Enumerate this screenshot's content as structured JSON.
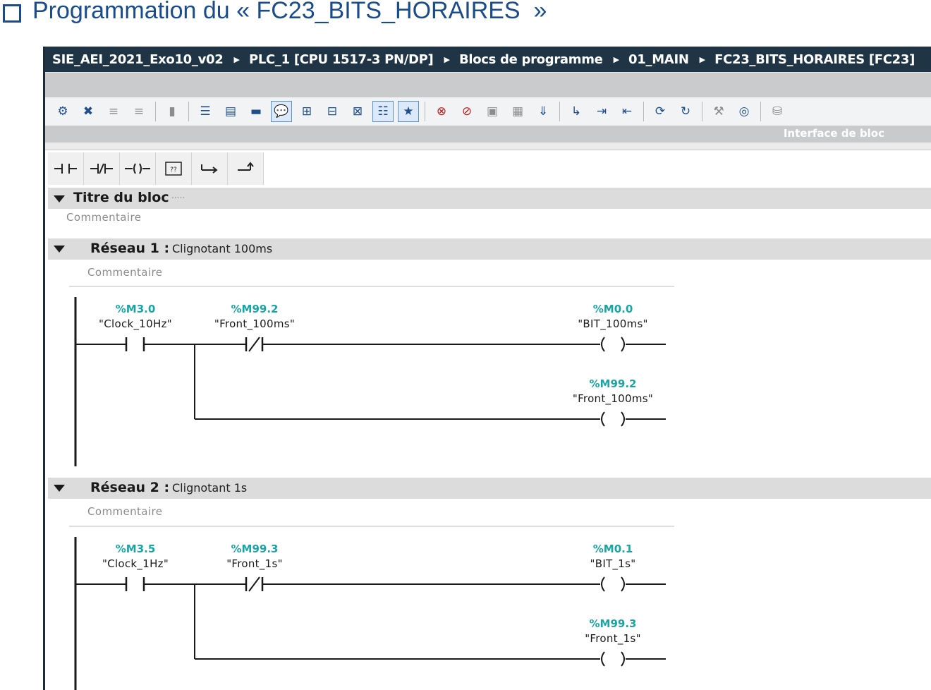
{
  "slide": {
    "title": "Programmation du « FC23_BITS_HORAIRES  »"
  },
  "breadcrumb": [
    "SIE_AEI_2021_Exo10_v02",
    "PLC_1 [CPU 1517-3 PN/DP]",
    "Blocs de programme",
    "01_MAIN",
    "FC23_BITS_HORAIRES [FC23]"
  ],
  "interface_label": "Interface de bloc",
  "block": {
    "title": "Titre du bloc",
    "title_dots": ".....",
    "comment": "Commentaire"
  },
  "networks": [
    {
      "label": "Réseau 1 :",
      "title": "Clignotant 100ms",
      "comment": "Commentaire",
      "contact_no": {
        "address": "%M3.0",
        "symbol": "\"Clock_10Hz\""
      },
      "contact_nc": {
        "address": "%M99.2",
        "symbol": "\"Front_100ms\""
      },
      "coil_1": {
        "address": "%M0.0",
        "symbol": "\"BIT_100ms\""
      },
      "coil_2": {
        "address": "%M99.2",
        "symbol": "\"Front_100ms\""
      }
    },
    {
      "label": "Réseau 2 :",
      "title": "Clignotant 1s",
      "comment": "Commentaire",
      "contact_no": {
        "address": "%M3.5",
        "symbol": "\"Clock_1Hz\""
      },
      "contact_nc": {
        "address": "%M99.3",
        "symbol": "\"Front_1s\""
      },
      "coil_1": {
        "address": "%M0.1",
        "symbol": "\"BIT_1s\""
      },
      "coil_2": {
        "address": "%M99.3",
        "symbol": "\"Front_1s\""
      }
    }
  ],
  "ladder_palette": [
    "no-contact-icon",
    "nc-contact-icon",
    "coil-icon",
    "empty-box-icon",
    "open-branch-icon",
    "close-branch-icon"
  ],
  "colors": {
    "breadcrumb_bg": "#1f3445",
    "address_teal": "#1aa5a5",
    "slide_title_blue": "#1a4c8c",
    "section_gray": "#dcdcdc"
  }
}
